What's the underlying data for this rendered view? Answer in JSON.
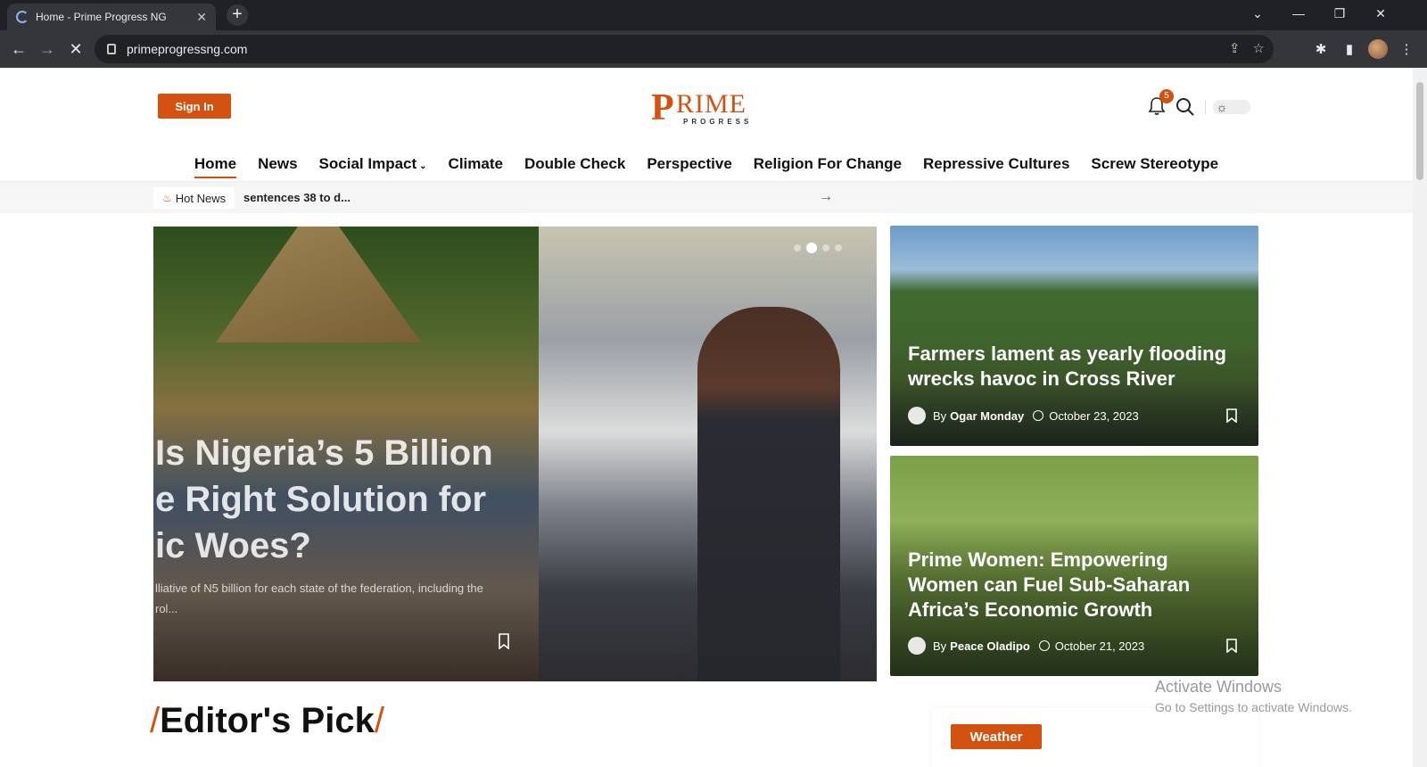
{
  "browser": {
    "tab_title": "Home - Prime Progress NG",
    "new_tab": "+",
    "url": "primeprogressng.com",
    "profile_icon": "profile-avatar"
  },
  "header": {
    "sign_in_label": "Sign In",
    "logo_p": "P",
    "logo_rime": "RIME",
    "logo_progress": "PROGRESS",
    "notification_count": "5",
    "brand_color": "#d3520f"
  },
  "nav": {
    "items": [
      "Home",
      "News",
      "Social Impact",
      "Climate",
      "Double Check",
      "Perspective",
      "Religion For Change",
      "Repressive Cultures",
      "Screw Stereotype"
    ],
    "active": "Home"
  },
  "hot_news": {
    "label": "Hot News",
    "text": "sentences 38 to d...",
    "next": "→"
  },
  "hero": {
    "title": "Is Nigeria’s 5 Billion\ne Right Solution for\nic Woes?",
    "excerpt": "lliative of N5 billion for each state of the federation, including the\nrol...",
    "slides_total": 4,
    "slide_active": 2
  },
  "cards": [
    {
      "title": "Farmers lament as yearly flooding\nwrecks havoc in Cross River",
      "by": "By",
      "author": "Ogar Monday",
      "date": "October 23, 2023"
    },
    {
      "title": "Prime Women: Empowering\nWomen can Fuel Sub-Saharan\nAfrica’s Economic Growth",
      "by": "By",
      "author": "Peace Oladipo",
      "date": "October 21, 2023"
    }
  ],
  "section": {
    "slash_left": "/",
    "title": "Editor's Pick",
    "slash_right": "/"
  },
  "weather": {
    "label": "Weather"
  },
  "activate_windows": {
    "line1": "Activate Windows",
    "line2": "Go to Settings to activate Windows."
  }
}
